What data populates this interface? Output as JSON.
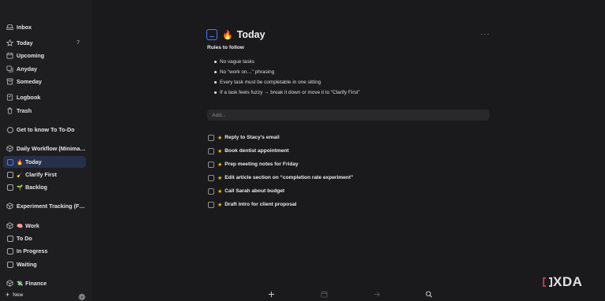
{
  "sidebar": {
    "items": [
      {
        "label": "Inbox",
        "icon": "inbox-icon",
        "count": ""
      },
      {
        "label": "Today",
        "icon": "star-icon",
        "count": "7"
      },
      {
        "label": "Upcoming",
        "icon": "calendar-icon",
        "count": ""
      },
      {
        "label": "Anyday",
        "icon": "layers-icon",
        "count": ""
      },
      {
        "label": "Someday",
        "icon": "archive-icon",
        "count": ""
      },
      {
        "label": "Logbook",
        "icon": "book-icon",
        "count": ""
      },
      {
        "label": "Trash",
        "icon": "trash-icon",
        "count": ""
      },
      {
        "label": "Get to know To To-Do",
        "icon": "circle-icon",
        "count": ""
      },
      {
        "label": "Daily Workflow (Minimali...",
        "icon": "cube-icon",
        "count": ""
      },
      {
        "label": "Today",
        "icon": "fire-emoji-icon",
        "emoji": "🔥",
        "count": ""
      },
      {
        "label": "Clarify First",
        "icon": "sparkle-emoji-icon",
        "emoji": "🧹",
        "count": ""
      },
      {
        "label": "Backlog",
        "icon": "plant-emoji-icon",
        "emoji": "🌱",
        "count": ""
      },
      {
        "label": "Experiment Tracking (For...",
        "icon": "cube-icon",
        "count": ""
      },
      {
        "label": "Work",
        "icon": "brain-emoji-icon",
        "emoji": "🧠",
        "count": ""
      },
      {
        "label": "To Do",
        "icon": "square-icon",
        "count": ""
      },
      {
        "label": "In Progress",
        "icon": "square-icon",
        "count": ""
      },
      {
        "label": "Waiting",
        "icon": "square-icon",
        "count": ""
      },
      {
        "label": "Finance",
        "icon": "money-emoji-icon",
        "emoji": "💸",
        "count": ""
      }
    ],
    "new_label": "New"
  },
  "page": {
    "title": "Today",
    "title_emoji": "🔥",
    "more": "···",
    "rules_heading": "Rules to follow",
    "rules": [
      "No vague tasks",
      "No “work on…” phrasing",
      "Every task must be completable in one sitting",
      "If a task feels fuzzy → break it down or move it to “Clarify First”"
    ],
    "add_placeholder": "Add...",
    "task_star": "★",
    "tasks": [
      "Reply to Stacy’s email",
      "Book dentist appointment",
      "Prep meeting notes for Friday",
      "Edit article section on “completion rate experiment”",
      "Call Sarah about budget",
      "Draft intro for client proposal"
    ]
  },
  "watermark": {
    "text": "XDA"
  },
  "colors": {
    "accent": "#4a7bff",
    "star": "#f6b81c",
    "active_bg": "#263049",
    "watermark_mark": "#c4304a"
  }
}
